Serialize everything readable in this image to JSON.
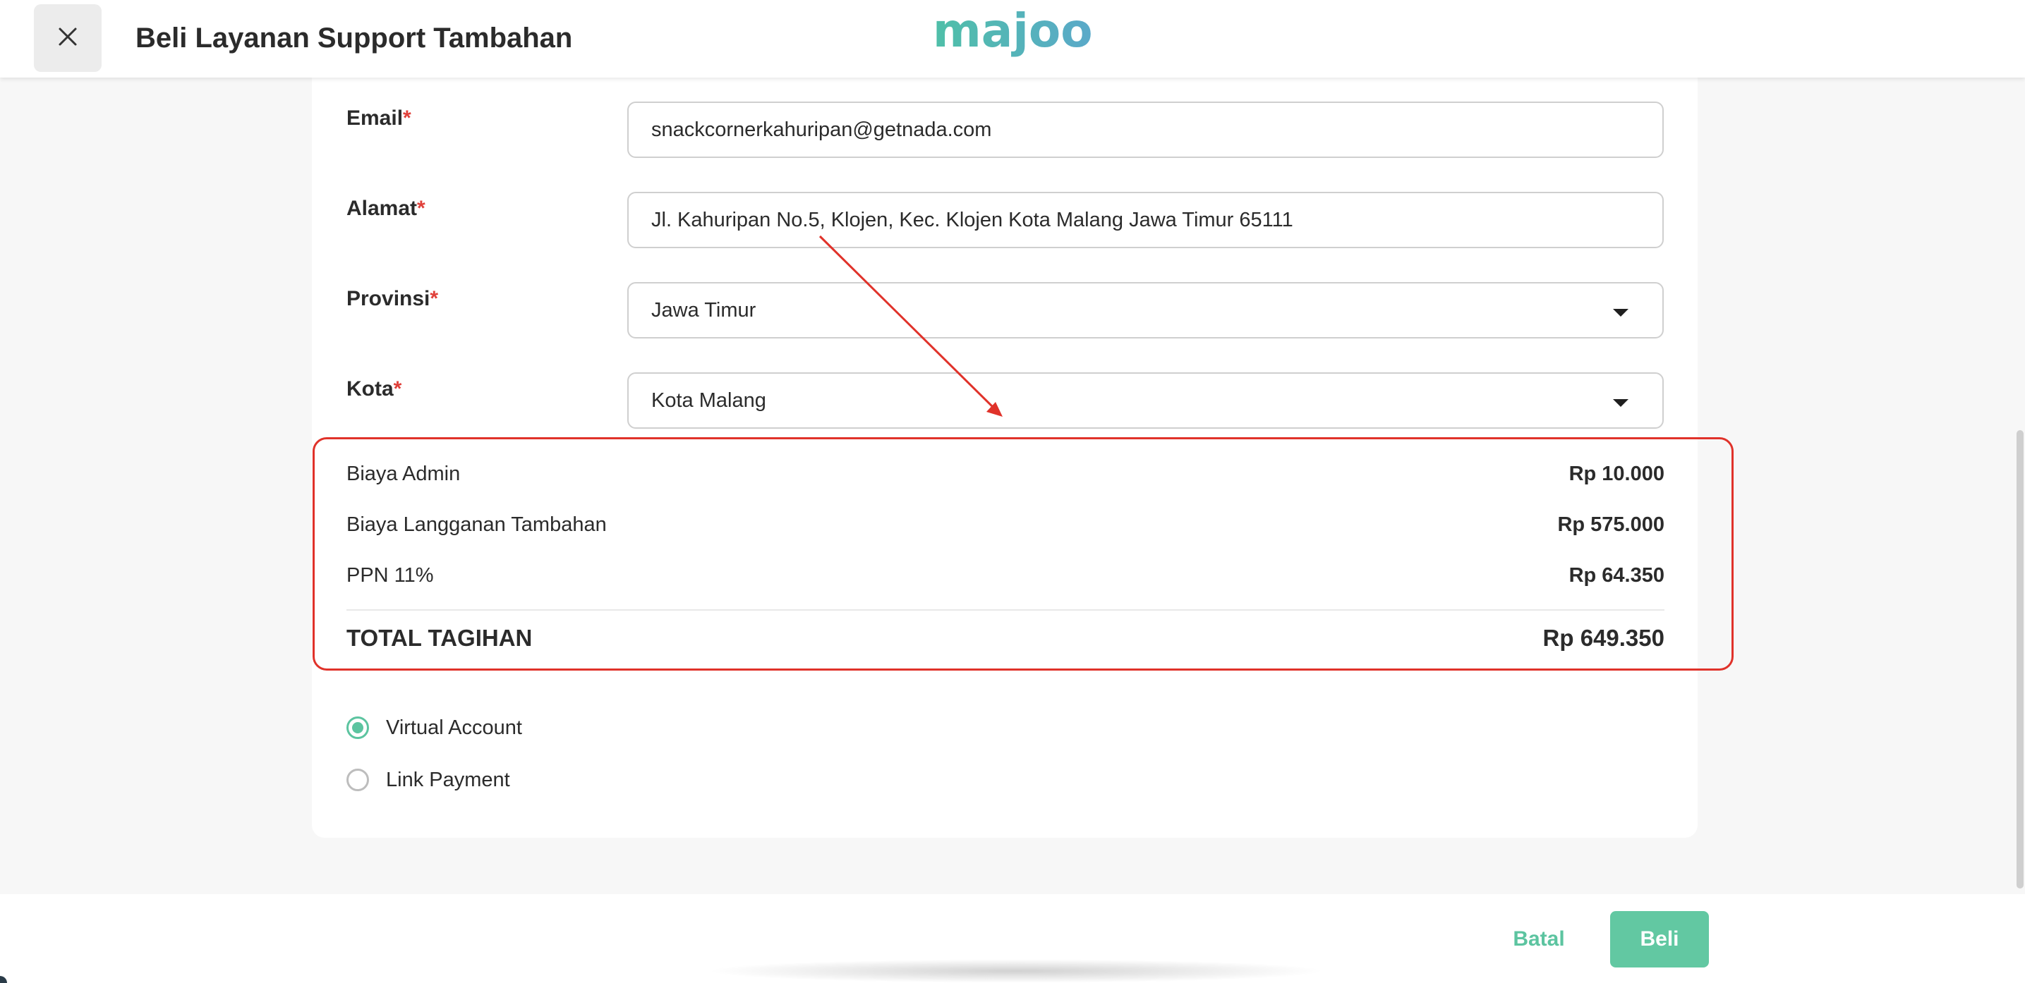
{
  "header": {
    "title": "Beli Layanan Support Tambahan",
    "logo_text": "majoo",
    "close_icon": "close-icon"
  },
  "form": {
    "email": {
      "label": "Email",
      "required_mark": "*",
      "value": "snackcornerkahuripan@getnada.com"
    },
    "alamat": {
      "label": "Alamat",
      "required_mark": "*",
      "value": "Jl. Kahuripan No.5,  Klojen,  Kec. Klojen Kota Malang Jawa Timur 65111"
    },
    "provinsi": {
      "label": "Provinsi",
      "required_mark": "*",
      "value": "Jawa Timur",
      "icon": "caret-down-icon"
    },
    "kota": {
      "label": "Kota",
      "required_mark": "*",
      "value": "Kota Malang",
      "icon": "caret-down-icon"
    }
  },
  "summary": {
    "items": [
      {
        "label": "Biaya Admin",
        "value": "Rp 10.000"
      },
      {
        "label": "Biaya Langganan Tambahan",
        "value": "Rp 575.000"
      },
      {
        "label": "PPN 11%",
        "value": "Rp 64.350"
      }
    ],
    "total_label": "TOTAL TAGIHAN",
    "total_value": "Rp 649.350"
  },
  "payment": {
    "options": [
      {
        "label": "Virtual Account",
        "selected": true
      },
      {
        "label": "Link Payment",
        "selected": false
      }
    ]
  },
  "footer": {
    "cancel_label": "Batal",
    "buy_label": "Beli"
  },
  "colors": {
    "accent": "#5cc4a0",
    "highlight": "#e0322a",
    "required": "#e0403a"
  }
}
